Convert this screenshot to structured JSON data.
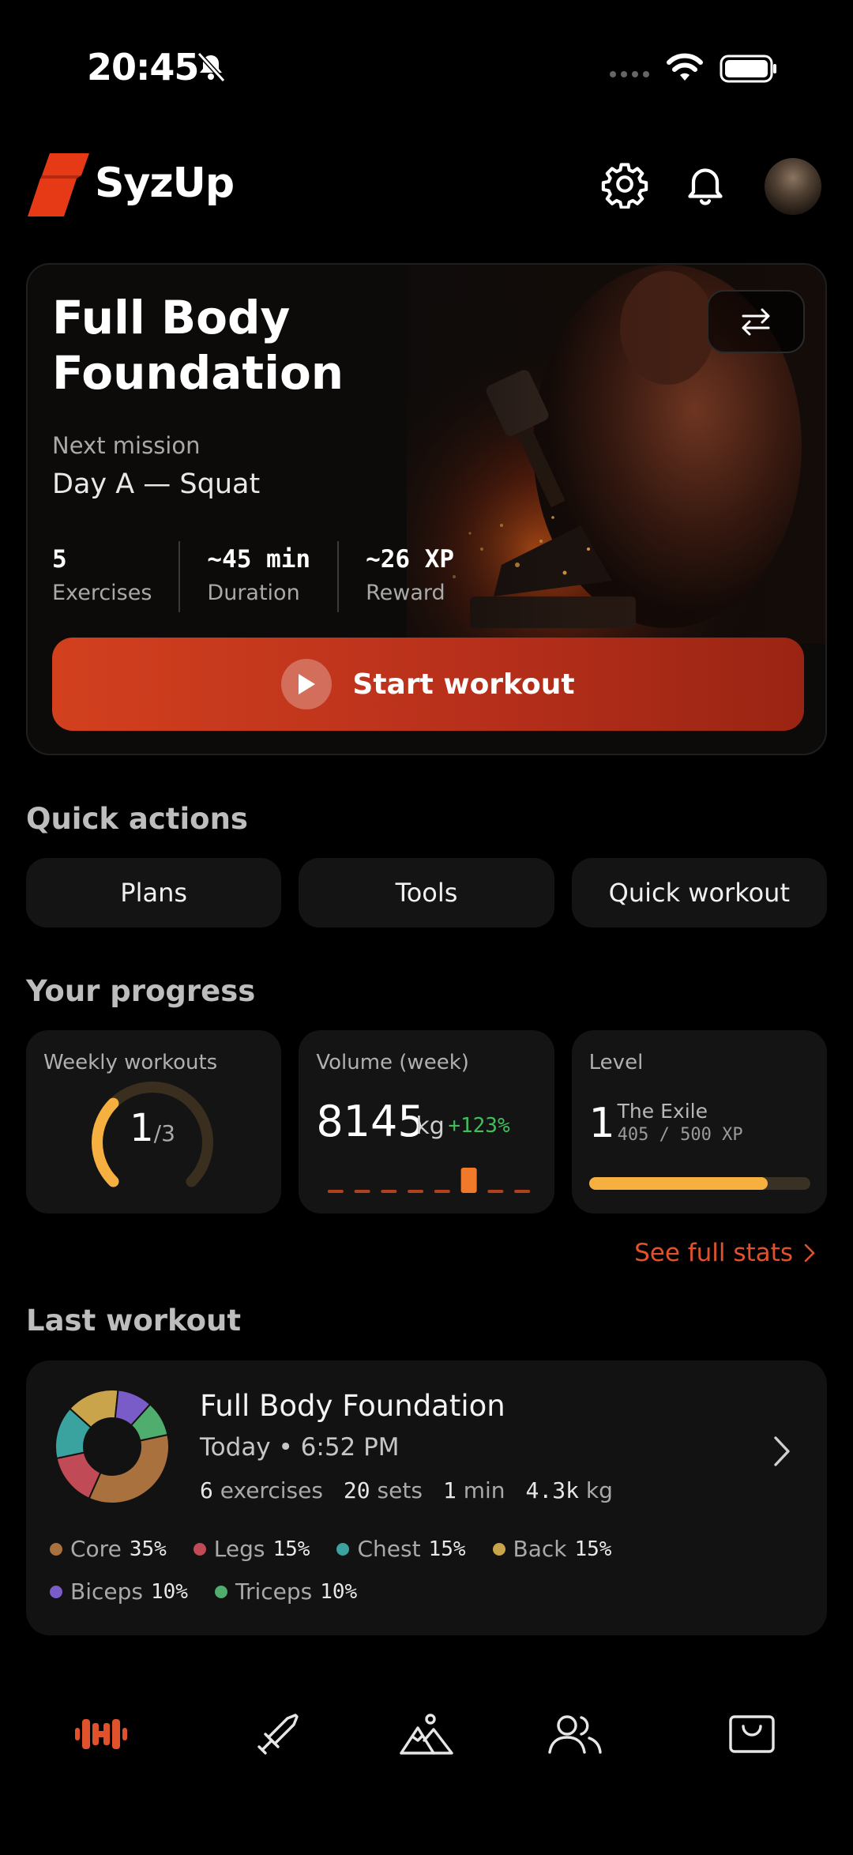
{
  "status_bar": {
    "time": "20:45"
  },
  "header": {
    "brand": "SyzUp"
  },
  "hero": {
    "title": "Full Body Foundation",
    "next_mission_label": "Next mission",
    "next_mission": "Day A — Squat",
    "stats": [
      {
        "value": "5",
        "label": "Exercises"
      },
      {
        "value": "~45 min",
        "label": "Duration"
      },
      {
        "value": "~26 XP",
        "label": "Reward"
      }
    ],
    "start_label": "Start workout"
  },
  "quick_actions": {
    "title": "Quick actions",
    "items": [
      "Plans",
      "Tools",
      "Quick workout"
    ]
  },
  "progress": {
    "title": "Your progress",
    "weekly": {
      "label": "Weekly workouts",
      "done": "1",
      "target": "/3",
      "fraction": 0.333
    },
    "volume": {
      "label": "Volume (week)",
      "value": "8145",
      "unit": "kg",
      "change": "+123%",
      "bars_relative": [
        0,
        0,
        0,
        0,
        0,
        1,
        0,
        0
      ]
    },
    "level": {
      "label": "Level",
      "number": "1",
      "name": "The Exile",
      "xp": "405 / 500 XP",
      "fraction": 0.81
    },
    "see_stats": "See full stats"
  },
  "last_workout": {
    "title": "Last workout",
    "name": "Full Body Foundation",
    "date": "Today • 6:52 PM",
    "stats": [
      {
        "num": "6",
        "label": "exercises"
      },
      {
        "num": "20",
        "label": "sets"
      },
      {
        "num": "1",
        "label": "min"
      },
      {
        "num": "4.3k",
        "label": "kg"
      }
    ],
    "muscles": [
      {
        "name": "Core",
        "pct": "35%",
        "value": 35,
        "color": "#a8713d"
      },
      {
        "name": "Legs",
        "pct": "15%",
        "value": 15,
        "color": "#c04a55"
      },
      {
        "name": "Chest",
        "pct": "15%",
        "value": 15,
        "color": "#3aa3a0"
      },
      {
        "name": "Back",
        "pct": "15%",
        "value": 15,
        "color": "#c9a44a"
      },
      {
        "name": "Biceps",
        "pct": "10%",
        "value": 10,
        "color": "#7a5cc8"
      },
      {
        "name": "Triceps",
        "pct": "10%",
        "value": 10,
        "color": "#4fae6e"
      }
    ]
  },
  "colors": {
    "accent": "#e0522b",
    "level_bar": "#f6b040",
    "positive": "#3fbf5c"
  },
  "nav": {
    "items": [
      "dumbbell-icon",
      "sword-icon",
      "mountain-icon",
      "people-icon",
      "bag-icon"
    ],
    "active": "dumbbell-icon"
  }
}
